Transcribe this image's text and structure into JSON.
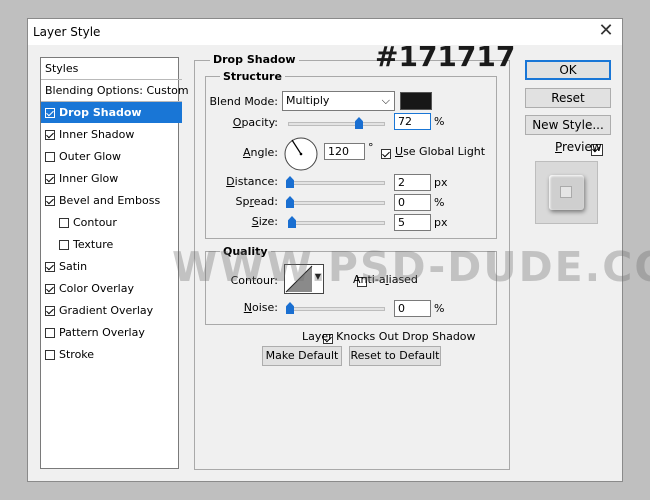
{
  "window": {
    "title": "Layer Style",
    "close_icon": "close-icon"
  },
  "sidebar": {
    "items": [
      {
        "label": "Styles",
        "checkbox": false
      },
      {
        "label": "Blending Options: Custom",
        "checkbox": false
      },
      {
        "label": "Drop Shadow",
        "checkbox": true,
        "checked": true,
        "selected": true
      },
      {
        "label": "Inner Shadow",
        "checkbox": true,
        "checked": true
      },
      {
        "label": "Outer Glow",
        "checkbox": true,
        "checked": false
      },
      {
        "label": "Inner Glow",
        "checkbox": true,
        "checked": true
      },
      {
        "label": "Bevel and Emboss",
        "checkbox": true,
        "checked": true
      },
      {
        "label": "Contour",
        "checkbox": true,
        "checked": false,
        "indent": true
      },
      {
        "label": "Texture",
        "checkbox": true,
        "checked": false,
        "indent": true
      },
      {
        "label": "Satin",
        "checkbox": true,
        "checked": true
      },
      {
        "label": "Color Overlay",
        "checkbox": true,
        "checked": true
      },
      {
        "label": "Gradient Overlay",
        "checkbox": true,
        "checked": true
      },
      {
        "label": "Pattern Overlay",
        "checkbox": true,
        "checked": false
      },
      {
        "label": "Stroke",
        "checkbox": true,
        "checked": false
      }
    ]
  },
  "drop_shadow": {
    "title": "Drop Shadow",
    "structure": {
      "title": "Structure",
      "blend_mode_label": "Blend Mode:",
      "blend_mode_value": "Multiply",
      "shadow_color": "#171717",
      "opacity_label": "Opacity:",
      "opacity_value": "72",
      "opacity_fraction": 0.72,
      "percent": "%",
      "angle_label": "Angle:",
      "angle_value": "120",
      "degree": "°",
      "use_global_light_label": "Use Global Light",
      "use_global_light_checked": true,
      "distance_label": "Distance:",
      "distance_value": "2",
      "px": "px",
      "spread_label": "Spread:",
      "spread_value": "0",
      "size_label": "Size:",
      "size_value": "5"
    },
    "quality": {
      "title": "Quality",
      "contour_label": "Contour:",
      "anti_aliased_label": "Anti-aliased",
      "anti_aliased_checked": false,
      "noise_label": "Noise:",
      "noise_value": "0"
    },
    "knocks_out_label": "Layer Knocks Out Drop Shadow",
    "knocks_out_checked": true,
    "make_default_label": "Make Default",
    "reset_default_label": "Reset to Default"
  },
  "buttons": {
    "ok": "OK",
    "reset": "Reset",
    "new_style": "New Style...",
    "preview": "Preview",
    "preview_checked": true
  },
  "overlay": {
    "hex_label": "#171717",
    "watermark": "WWW.PSD-DUDE.COM"
  }
}
